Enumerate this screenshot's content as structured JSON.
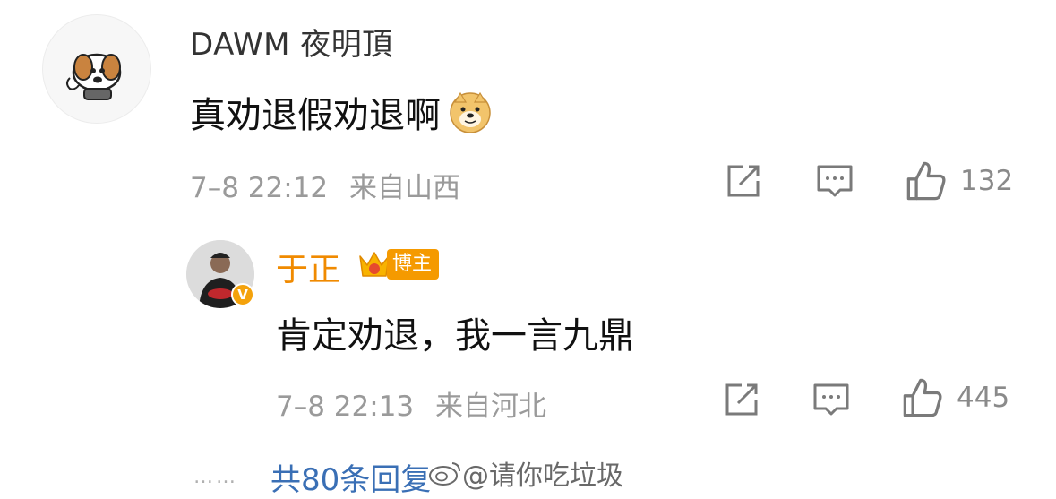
{
  "comment": {
    "username": "DAWM 夜明頂",
    "text": "真劝退假劝退啊",
    "emoji": "doge-emoji",
    "time": "7–8 22:12",
    "location": "来自山西",
    "likes": "132"
  },
  "reply": {
    "username": "于正",
    "badge": "博主",
    "text": "肯定劝退，我一言九鼎",
    "time": "7–8 22:13",
    "location": "来自河北",
    "likes": "445"
  },
  "footer": {
    "dots": "……",
    "more_replies": "共80条回复",
    "watermark": "@请你吃垃圾"
  },
  "colors": {
    "username_reply": "#f08a00",
    "link": "#3a6fb5",
    "meta": "#9a9a9a"
  }
}
